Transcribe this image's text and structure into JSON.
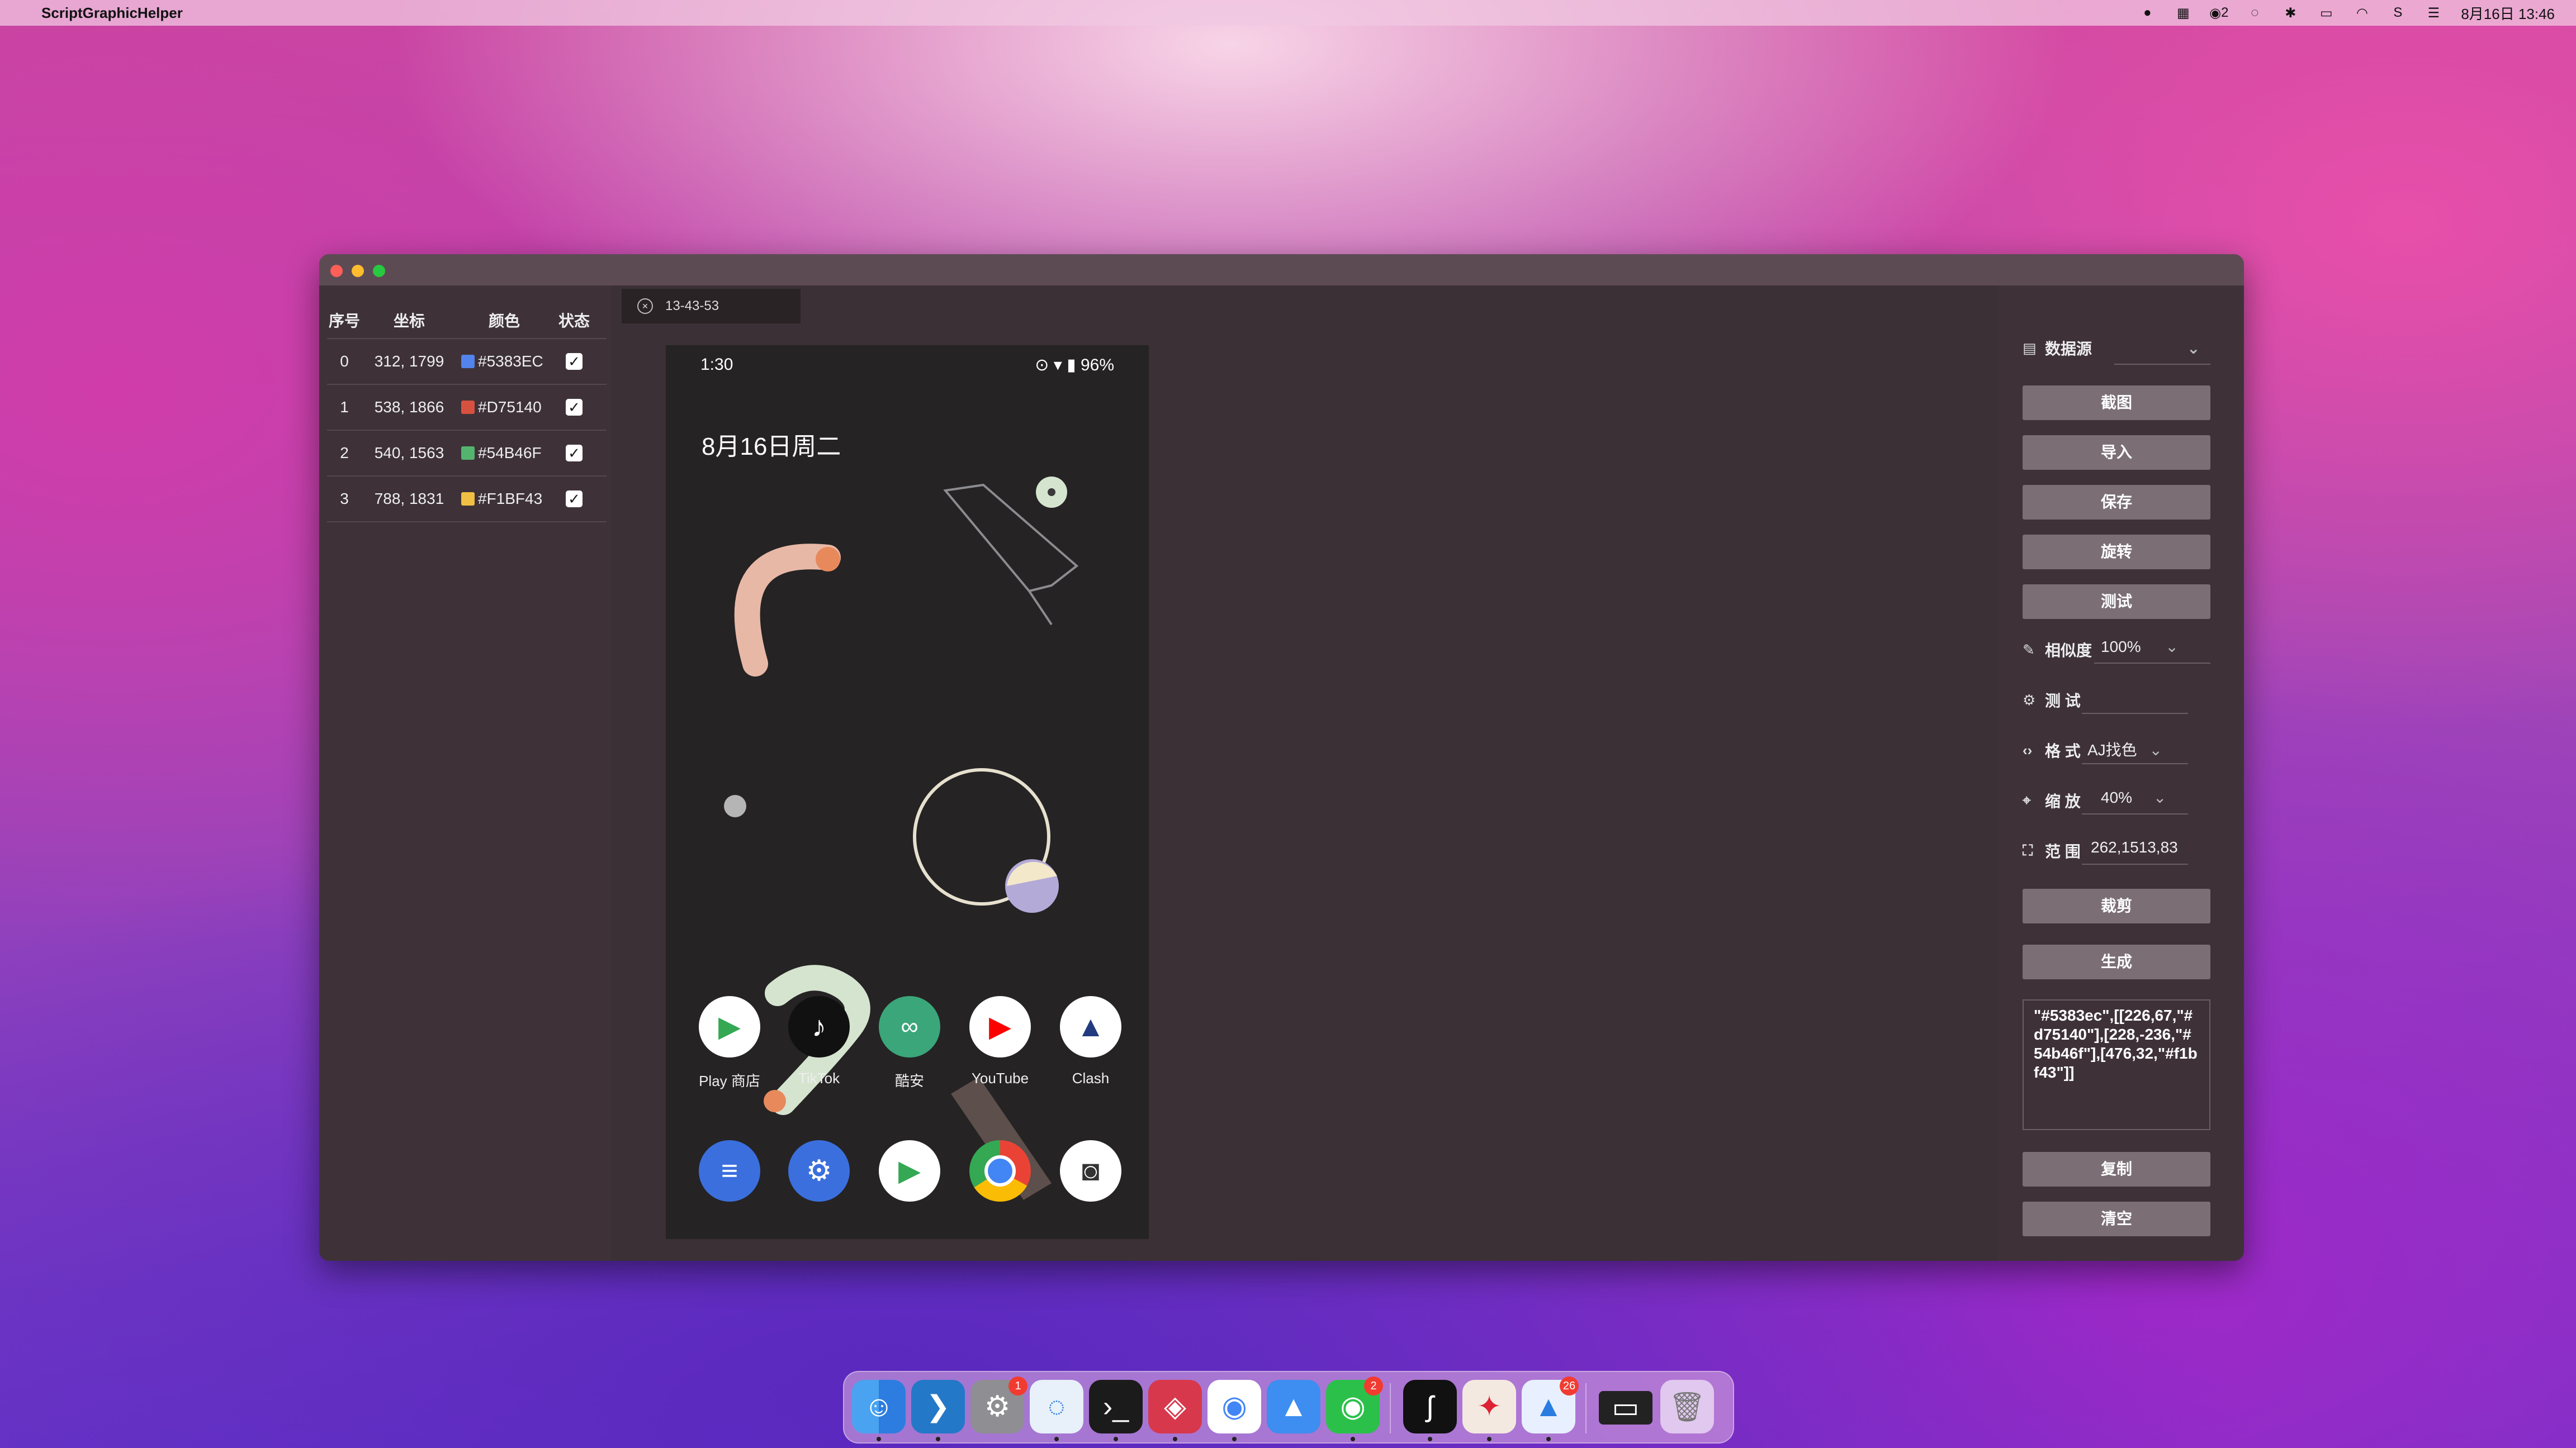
{
  "menubar": {
    "app_name": "ScriptGraphicHelper",
    "wechat_count": "2",
    "datetime": "8月16日 13:46"
  },
  "window": {
    "table": {
      "headers": [
        "序号",
        "坐标",
        "颜色",
        "状态"
      ],
      "rows": [
        {
          "index": "0",
          "coord": "312, 1799",
          "color": "#5383EC",
          "checked": true
        },
        {
          "index": "1",
          "coord": "538, 1866",
          "color": "#D75140",
          "checked": true
        },
        {
          "index": "2",
          "coord": "540, 1563",
          "color": "#54B46F",
          "checked": true
        },
        {
          "index": "3",
          "coord": "788, 1831",
          "color": "#F1BF43",
          "checked": true
        }
      ]
    },
    "tab_label": "13-43-53",
    "phone": {
      "time": "1:30",
      "battery": "96%",
      "date": "8月16日周二",
      "apps_row1": [
        {
          "label": "Play 商店",
          "icon": "play-store-icon"
        },
        {
          "label": "TikTok",
          "icon": "tiktok-icon"
        },
        {
          "label": "酷安",
          "icon": "coolapk-icon"
        },
        {
          "label": "YouTube",
          "icon": "youtube-icon"
        },
        {
          "label": "Clash",
          "icon": "clash-icon"
        }
      ],
      "apps_row2": [
        "messages-icon",
        "settings-icon",
        "play-store-icon",
        "chrome-icon",
        "camera-icon"
      ]
    },
    "right": {
      "datasource_label": "数据源",
      "btn_screenshot": "截图",
      "btn_import": "导入",
      "btn_save": "保存",
      "btn_rotate": "旋转",
      "btn_test": "测试",
      "similarity_label": "相似度",
      "similarity_value": "100%",
      "test_label": "测 试",
      "format_label": "格 式",
      "format_value": "AJ找色",
      "zoom_label": "缩 放",
      "zoom_value": "40%",
      "range_label": "范 围",
      "range_value": "262,1513,83",
      "btn_crop": "裁剪",
      "btn_generate": "生成",
      "output": "\"#5383ec\",[[226,67,\"#d75140\"],[228,-236,\"#54b46f\"],[476,32,\"#f1bf43\"]]",
      "btn_copy": "复制",
      "btn_clear": "清空"
    }
  },
  "dock": {
    "badges": {
      "settings": "1",
      "wechat": "2",
      "testflight": "26"
    }
  }
}
